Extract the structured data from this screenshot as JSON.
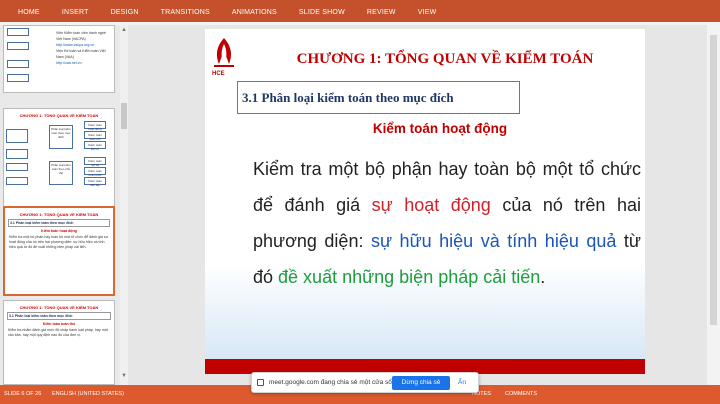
{
  "ribbon": {
    "tabs": [
      "HOME",
      "INSERT",
      "DESIGN",
      "TRANSITIONS",
      "ANIMATIONS",
      "SLIDE SHOW",
      "REVIEW",
      "VIEW"
    ]
  },
  "thumbnails": {
    "t1": {
      "lines": [
        "Viện Kiểm toán viên hành nghề Việt Nam (VACPA)",
        "http://www.vacpa.org.vn",
        "Viện Kế toán và Kiểm toán Việt Nam (VAA)",
        "http://vaa.net.vn"
      ]
    },
    "t2": {
      "title": "CHƯƠNG 1: TỔNG QUAN VỀ KIỂM TOÁN",
      "boxes": [
        "Phân loại kiểm toán theo mục đích",
        "Kiểm toán hoạt động",
        "Kiểm toán tuân thủ",
        "Kiểm toán BCTC",
        "Phân loại kiểm toán theo chủ thể",
        "Kiểm toán nội bộ",
        "Kiểm toán nhà nước",
        "Kiểm toán độc lập"
      ]
    },
    "t3": {
      "title": "CHƯƠNG 1: TỔNG QUAN VỀ KIỂM TOÁN",
      "sub": "3.1 Phân loại kiểm toán theo mục đích",
      "heading": "Kiểm toán hoạt động",
      "body": "Kiểm tra một bộ phận hay toàn bộ một tổ chức để đánh giá sự hoạt động của nó trên hai phương diện: sự hữu hiệu và tính hiệu quả từ đó đề xuất những biện pháp cải tiến."
    },
    "t4": {
      "title": "CHƯƠNG 1: TỔNG QUAN VỀ KIỂM TOÁN",
      "sub": "3.1 Phân loại kiểm toán theo mục đích",
      "heading": "Kiểm toán tuân thủ",
      "body": "Kiểm tra nhằm đánh giá mức độ chấp hành luật pháp, hay một văn bản, hay một quy định nào đó của đơn vị."
    }
  },
  "slide": {
    "logo_text": "HCE",
    "title": "CHƯƠNG 1: TỔNG QUAN VỀ KIỂM TOÁN",
    "subtitle": "3.1 Phân loại kiểm toán theo mục đích",
    "heading": "Kiểm toán hoạt động",
    "p1": "Kiểm tra một bộ phận hay toàn bộ một tổ chức để đánh giá ",
    "p2": "sự hoạt động",
    "p3": " của nó trên hai phương diện: ",
    "p4": "sự hữu hiệu và tính hiệu quả",
    "p5": " từ đó ",
    "p6": "đề xuất những biện pháp cải tiến",
    "p7": ".",
    "colors": {
      "title": "#c00000",
      "highlight_red": "#d0202a",
      "highlight_blue": "#1a56b8",
      "highlight_green": "#1f9d3a"
    }
  },
  "status": {
    "slide_count": "SLIDE 6 OF 26",
    "language": "ENGLISH (UNITED STATES)",
    "notes": "NOTES",
    "comments": "COMMENTS"
  },
  "share_bar": {
    "text": "meet.google.com đang chia sẻ một cửa sổ.",
    "button": "Dừng chia sẻ",
    "hide": "Ẩn"
  }
}
